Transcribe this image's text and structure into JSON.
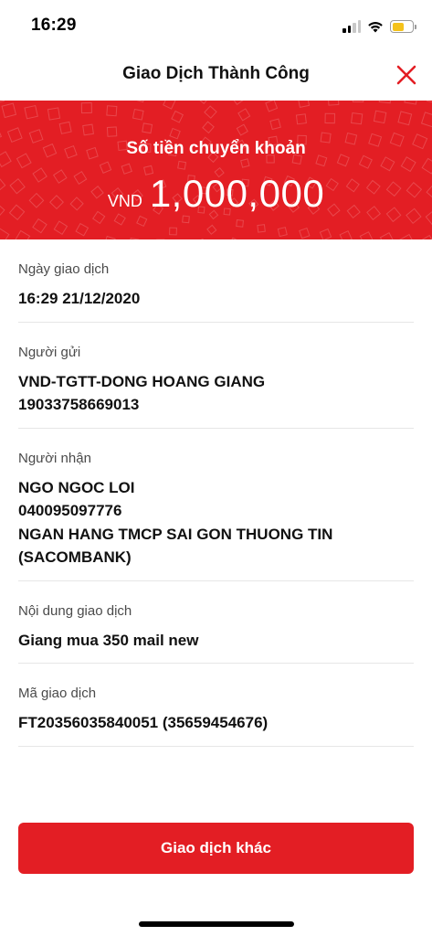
{
  "status_bar": {
    "time": "16:29",
    "icons": [
      "signal-icon",
      "wifi-icon",
      "battery-icon"
    ],
    "battery_level": 0.6,
    "battery_color": "#f4c21b"
  },
  "header": {
    "title": "Giao Dịch Thành Công",
    "close_icon": "close-icon",
    "close_color": "#e31e24"
  },
  "banner": {
    "label": "Số tiền chuyển khoản",
    "currency": "VND",
    "amount": "1,000,000",
    "background_color": "#e31e24"
  },
  "details": [
    {
      "label": "Ngày giao dịch",
      "values": [
        "16:29 21/12/2020"
      ]
    },
    {
      "label": "Người gửi",
      "values": [
        "VND-TGTT-DONG HOANG GIANG",
        "19033758669013"
      ]
    },
    {
      "label": "Người nhận",
      "values": [
        "NGO NGOC LOI",
        "040095097776",
        "NGAN HANG TMCP SAI GON THUONG TIN (SACOMBANK)"
      ]
    },
    {
      "label": "Nội dung giao dịch",
      "values": [
        "Giang mua 350 mail new"
      ]
    },
    {
      "label": "Mã giao dịch",
      "values": [
        "FT20356035840051 (35659454676)"
      ]
    }
  ],
  "action_button": {
    "label": "Giao dịch khác",
    "color": "#e31e24"
  }
}
